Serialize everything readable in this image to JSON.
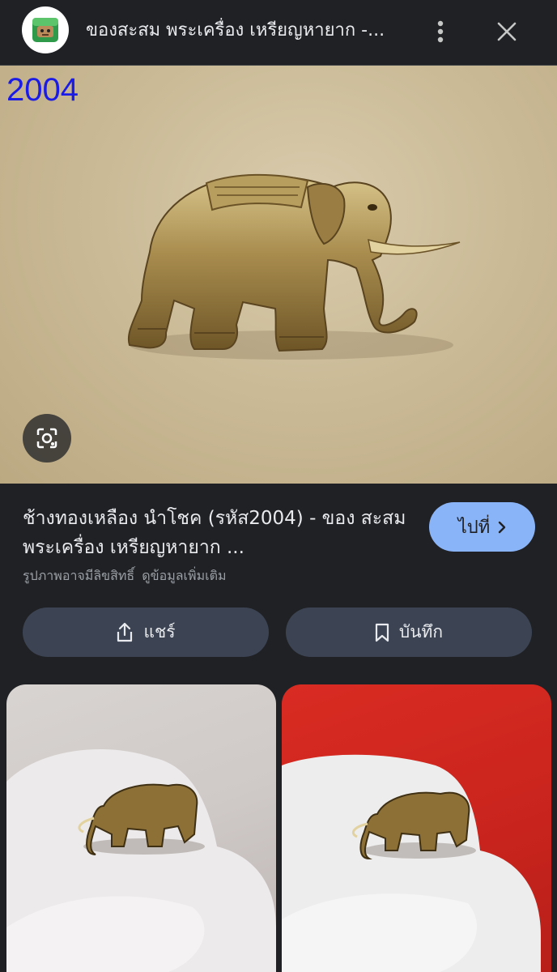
{
  "header": {
    "site_logo_icon": "green-character-logo",
    "title": "ของสะสม พระเครื่อง เหรียญหายาก -...",
    "more_icon": "more-vert-icon",
    "close_icon": "close-icon"
  },
  "main_image": {
    "watermark": "2004",
    "subject": "brass-elephant-figure",
    "lens_icon": "google-lens-icon"
  },
  "result": {
    "title": "ช้างทองเหลือง นำโชค (รหัส2004) - ของ สะสม พระเครื่อง เหรียญหายาก ...",
    "visit_label": "ไปที่",
    "copyright_text": "รูปภาพอาจมีลิขสิทธิ์",
    "more_info_label": "ดูข้อมูลเพิ่มเติม"
  },
  "actions": {
    "share_label": "แชร์",
    "save_label": "บันทึก"
  },
  "related": {
    "items": [
      {
        "subject": "elephant-amulet-in-hand-gray-background"
      },
      {
        "subject": "elephant-amulet-in-hand-red-background"
      }
    ]
  },
  "colors": {
    "background": "#202124",
    "accent": "#8ab4f8",
    "button": "#3c4454",
    "watermark": "#1b1be8"
  }
}
